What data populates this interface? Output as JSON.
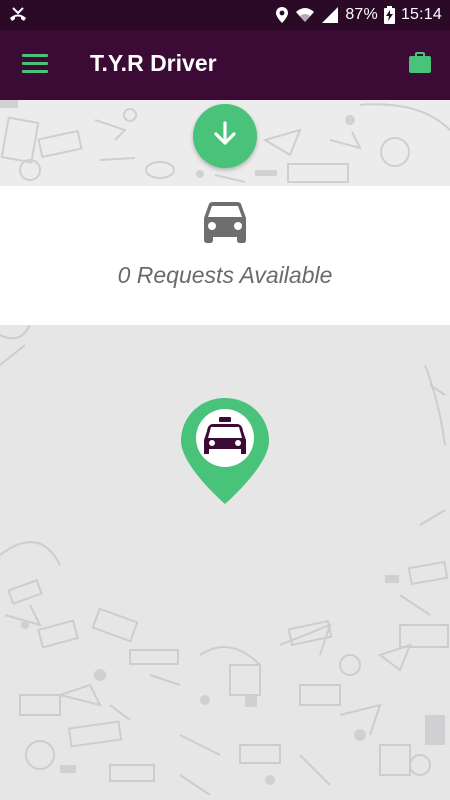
{
  "status_bar": {
    "battery_percent": "87%",
    "time": "15:14",
    "icons": [
      "missed-call-icon",
      "location-icon",
      "wifi-icon",
      "signal-icon",
      "battery-charging-icon"
    ]
  },
  "app_bar": {
    "title": "T.Y.R Driver",
    "menu_icon": "hamburger-menu-icon",
    "action_icon": "briefcase-icon"
  },
  "fab": {
    "icon": "download-arrow-icon"
  },
  "requests": {
    "icon": "car-icon",
    "text": "0 Requests Available"
  },
  "map_pin": {
    "icon": "taxi-pin-icon"
  },
  "colors": {
    "status_bar": "#2a0a26",
    "app_bar": "#3b0a35",
    "accent_green": "#49c27a",
    "pin_dark": "#3b0a35",
    "text_gray": "#6a6a6a"
  }
}
